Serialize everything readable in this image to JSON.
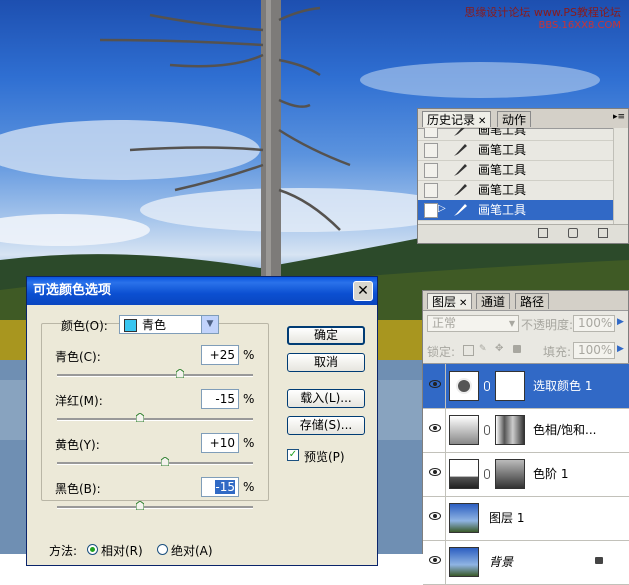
{
  "watermark": {
    "line1": "思缘设计论坛 www.PS教程论坛",
    "line2": "BBS.16XX8.COM"
  },
  "history": {
    "tabs": [
      "历史记录",
      "动作"
    ],
    "items": [
      {
        "label": "画笔工具",
        "selected": false
      },
      {
        "label": "画笔工具",
        "selected": false
      },
      {
        "label": "画笔工具",
        "selected": false
      },
      {
        "label": "画笔工具",
        "selected": false
      },
      {
        "label": "画笔工具",
        "selected": true
      }
    ]
  },
  "dialog": {
    "title": "可选颜色选项",
    "color_label": "颜色(O):",
    "color_value": "青色",
    "swatch_color": "#3ac6f0",
    "sliders": [
      {
        "label": "青色(C):",
        "value": "+25",
        "unit": "%",
        "level": 0.625
      },
      {
        "label": "洋红(M):",
        "value": "-15",
        "unit": "%",
        "level": 0.425
      },
      {
        "label": "黄色(Y):",
        "value": "+10",
        "unit": "%",
        "level": 0.55
      },
      {
        "label": "黑色(B):",
        "value": "-15",
        "unit": "%",
        "level": 0.425
      }
    ],
    "buttons": {
      "ok": "确定",
      "cancel": "取消",
      "load": "载入(L)...",
      "save": "存储(S)..."
    },
    "preview_label": "预览(P)",
    "method_label": "方法:",
    "relative_label": "相对(R)",
    "absolute_label": "绝对(A)"
  },
  "layers": {
    "tabs": [
      "图层",
      "通道",
      "路径"
    ],
    "blend_mode": "正常",
    "opacity_label": "不透明度:",
    "opacity_value": "100%",
    "lock_label": "锁定:",
    "fill_label": "填充:",
    "fill_value": "100%",
    "items": [
      {
        "name": "选取颜色 1",
        "selected": true
      },
      {
        "name": "色相/饱和...",
        "selected": false
      },
      {
        "name": "色阶 1",
        "selected": false
      },
      {
        "name": "图层 1",
        "selected": false
      },
      {
        "name": "背景",
        "selected": false
      }
    ]
  },
  "colors": {
    "selection": "#3169c6",
    "titlebar": "#0a55e0"
  }
}
